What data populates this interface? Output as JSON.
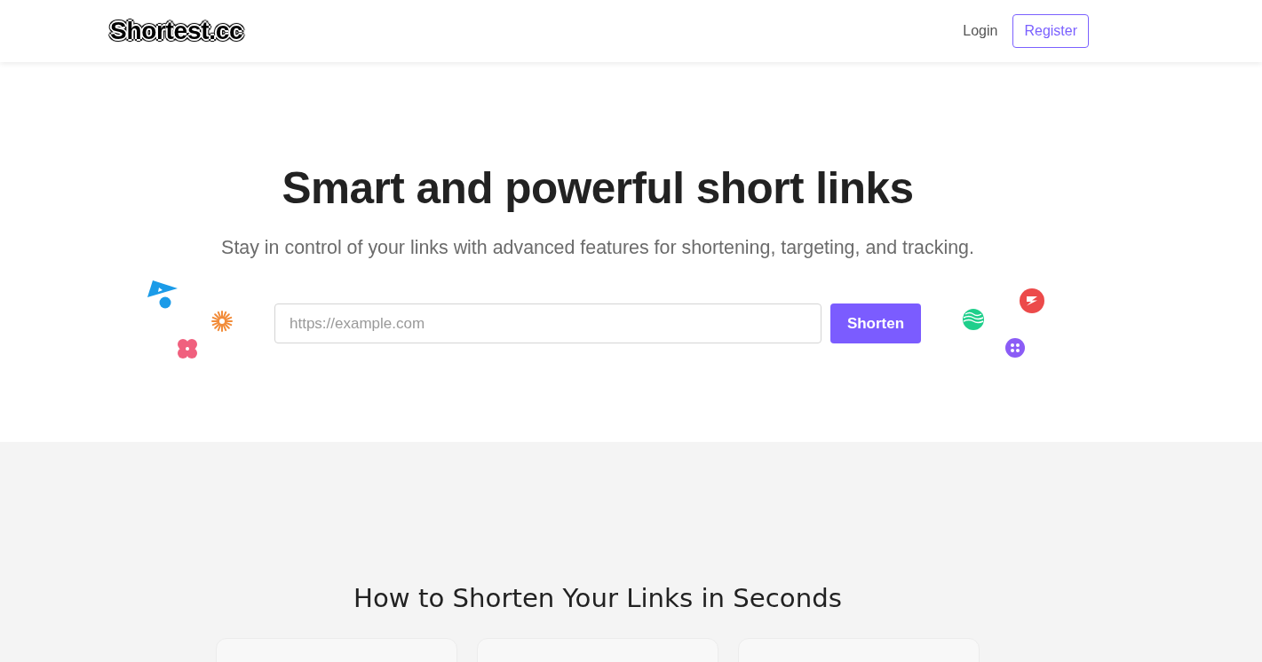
{
  "header": {
    "logo": "Shortest.cc",
    "nav": [
      {
        "kind": "link",
        "label": "Login"
      },
      {
        "kind": "outline_button",
        "label": "Register"
      }
    ]
  },
  "hero": {
    "title": "Smart and powerful short links",
    "subtitle": "Stay in control of your links with advanced features for shortening, targeting, and tracking.",
    "url_field": {
      "placeholder": "https://example.com"
    },
    "submit_button": "Shorten"
  },
  "how_to": {
    "heading": "How to Shorten Your Links in Seconds"
  }
}
